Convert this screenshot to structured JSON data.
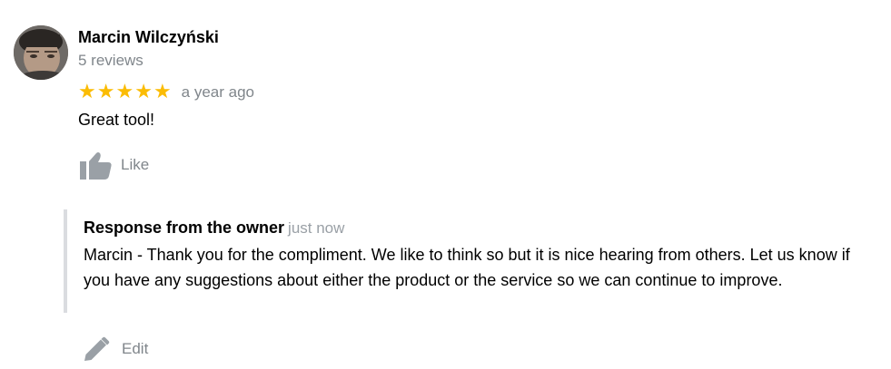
{
  "review": {
    "author_name": "Marcin Wilczyński",
    "review_count": "5 reviews",
    "rating": 5,
    "rating_max": 5,
    "time": "a year ago",
    "text": "Great tool!",
    "like_label": "Like",
    "like_icon": "thumbs-up-icon"
  },
  "owner_response": {
    "label": "Response from the owner",
    "time": "just now",
    "text": "Marcin - Thank you for the compliment. We like to think so but it is nice hearing from others. Let us know if you have any suggestions about either the product or the service so we can continue to improve."
  },
  "edit": {
    "label": "Edit",
    "icon": "pencil-icon"
  },
  "colors": {
    "star": "#fbbc04",
    "muted_text": "#80868b",
    "response_border": "#dadce0"
  }
}
